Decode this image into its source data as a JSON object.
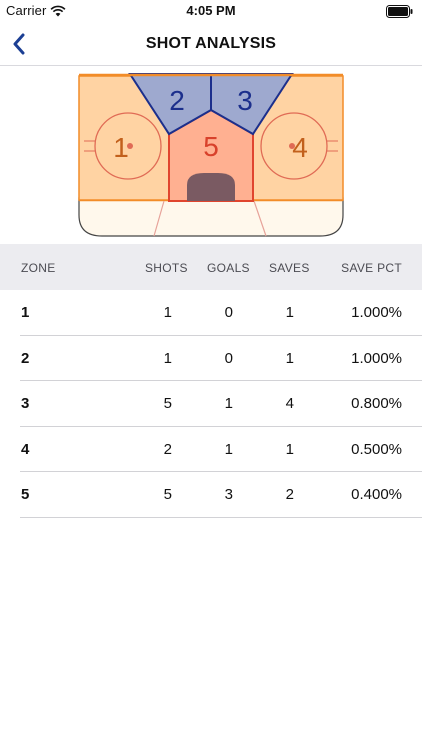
{
  "status": {
    "carrier": "Carrier",
    "time": "4:05 PM"
  },
  "nav": {
    "title": "SHOT ANALYSIS",
    "back_icon": "chevron-left-icon"
  },
  "rink": {
    "zones": [
      {
        "id": "1",
        "label": "1",
        "color": "#ffd3a3"
      },
      {
        "id": "2",
        "label": "2",
        "color": "#9ea9cf"
      },
      {
        "id": "3",
        "label": "3",
        "color": "#9ea9cf"
      },
      {
        "id": "4",
        "label": "4",
        "color": "#ffd3a3"
      },
      {
        "id": "5",
        "label": "5",
        "color": "#ffb091"
      }
    ],
    "colors": {
      "net_zone": "#9ea9cf",
      "slot_zone": "#ffb091",
      "circle_zone": "#ffd3a3",
      "border": "#f28c28",
      "crease": "#7a5a62",
      "ice": "#fff8ec"
    }
  },
  "table": {
    "headers": {
      "zone": "ZONE",
      "shots": "SHOTS",
      "goals": "GOALS",
      "saves": "SAVES",
      "pct": "SAVE PCT"
    },
    "rows": [
      {
        "zone": "1",
        "shots": "1",
        "goals": "0",
        "saves": "1",
        "pct": "1.000%"
      },
      {
        "zone": "2",
        "shots": "1",
        "goals": "0",
        "saves": "1",
        "pct": "1.000%"
      },
      {
        "zone": "3",
        "shots": "5",
        "goals": "1",
        "saves": "4",
        "pct": "0.800%"
      },
      {
        "zone": "4",
        "shots": "2",
        "goals": "1",
        "saves": "1",
        "pct": "0.500%"
      },
      {
        "zone": "5",
        "shots": "5",
        "goals": "3",
        "saves": "2",
        "pct": "0.400%"
      }
    ]
  }
}
